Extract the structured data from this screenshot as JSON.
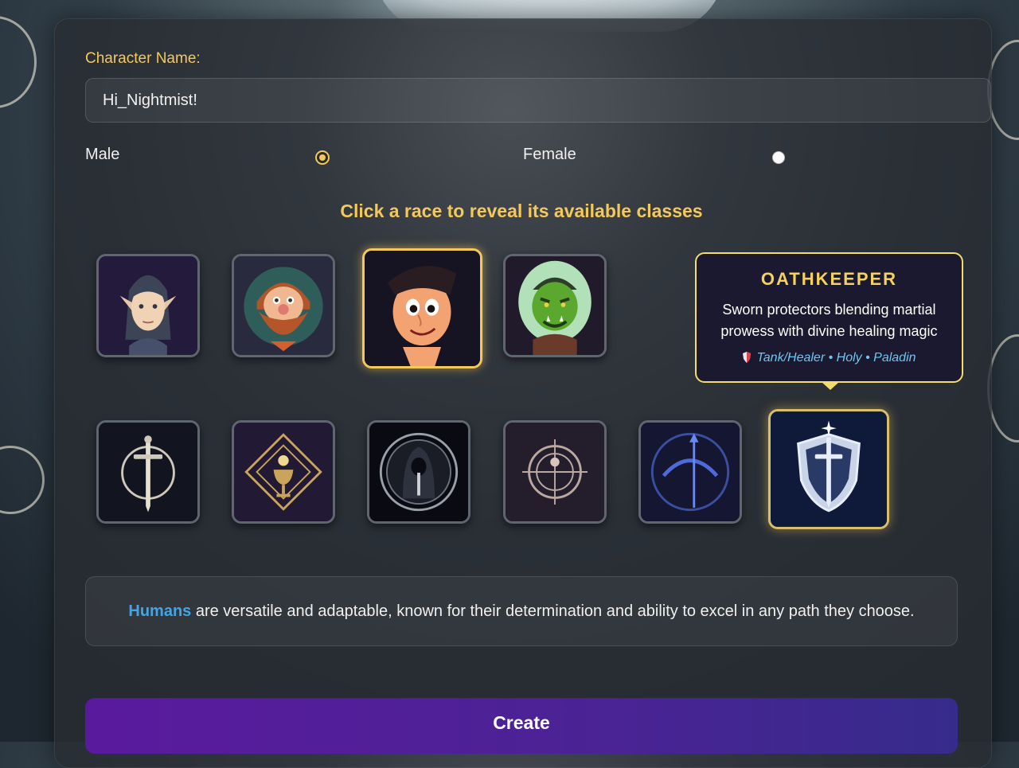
{
  "form": {
    "name_label": "Character Name:",
    "name_value": "Hi_Nightmist!",
    "gender_male": "Male",
    "gender_female": "Female",
    "selected_gender": "Male",
    "hint": "Click a race to reveal its available classes"
  },
  "races": [
    {
      "name": "elf-portrait",
      "selected": false
    },
    {
      "name": "dwarf-portrait",
      "selected": false
    },
    {
      "name": "human-portrait",
      "selected": true
    },
    {
      "name": "orc-portrait",
      "selected": false
    }
  ],
  "classes": [
    {
      "name": "sword-emblem-icon",
      "selected": false
    },
    {
      "name": "chalice-emblem-icon",
      "selected": false
    },
    {
      "name": "hooded-figure-emblem-icon",
      "selected": false
    },
    {
      "name": "rune-circle-emblem-icon",
      "selected": false
    },
    {
      "name": "bow-arrow-emblem-icon",
      "selected": false
    },
    {
      "name": "shield-sword-emblem-icon",
      "selected": true
    }
  ],
  "tooltip": {
    "title": "OATHKEEPER",
    "description": "Sworn protectors blending martial prowess with divine healing magic",
    "tags": "Tank/Healer • Holy • Paladin"
  },
  "info": {
    "race": "Humans",
    "text": " are versatile and adaptable, known for their determination and ability to excel in any path they choose."
  },
  "create_label": "Create",
  "colors": {
    "accent": "#f5c85a",
    "race_highlight": "#3fa6e8",
    "tag_color": "#6ec6f0",
    "button_gradient": [
      "#5a1a9e",
      "#362b8c"
    ]
  }
}
